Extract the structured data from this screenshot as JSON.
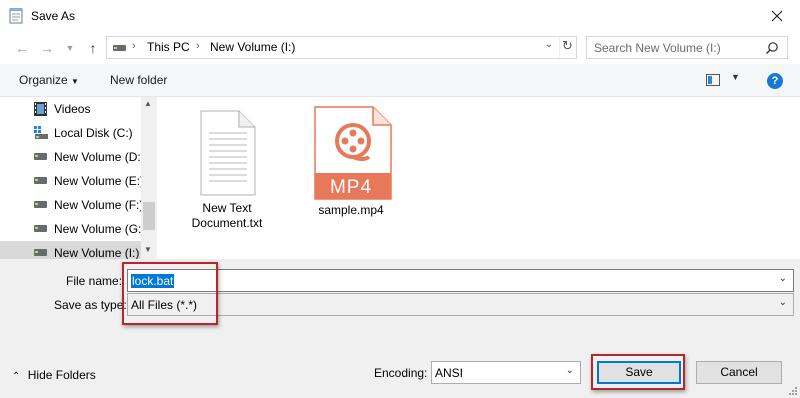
{
  "window": {
    "title": "Save As"
  },
  "address": {
    "segments": [
      "This PC",
      "New Volume (I:)"
    ]
  },
  "search": {
    "placeholder": "Search New Volume (I:)"
  },
  "toolbar": {
    "organize_label": "Organize",
    "new_folder_label": "New folder",
    "help_label": "?"
  },
  "nav": {
    "items": [
      {
        "label": "Videos",
        "icon": "video-icon",
        "selected": false
      },
      {
        "label": "Local Disk (C:)",
        "icon": "windows-drive-icon",
        "selected": false
      },
      {
        "label": "New Volume (D:",
        "icon": "drive-icon",
        "selected": false
      },
      {
        "label": "New Volume (E:)",
        "icon": "drive-icon",
        "selected": false
      },
      {
        "label": "New Volume (F:)",
        "icon": "drive-icon",
        "selected": false
      },
      {
        "label": "New Volume (G:",
        "icon": "drive-icon",
        "selected": false
      },
      {
        "label": "New Volume (I:)",
        "icon": "drive-icon",
        "selected": true
      }
    ]
  },
  "files": [
    {
      "name_line1": "New Text",
      "name_line2": "Document.txt",
      "icon": "text-document-icon"
    },
    {
      "name_line1": "sample.mp4",
      "name_line2": "",
      "icon": "mp4-video-icon",
      "badge": "MP4"
    }
  ],
  "form": {
    "filename_label": "File name:",
    "filename_value": "lock.bat",
    "savetype_label": "Save as type:",
    "savetype_value": "All Files  (*.*)",
    "encoding_label": "Encoding:",
    "encoding_value": "ANSI"
  },
  "footer": {
    "hide_folders_label": "Hide Folders",
    "save_label": "Save",
    "cancel_label": "Cancel"
  },
  "colors": {
    "accent": "#0078d7",
    "highlight_box": "#b3282d",
    "mp4": "#e8785a"
  }
}
